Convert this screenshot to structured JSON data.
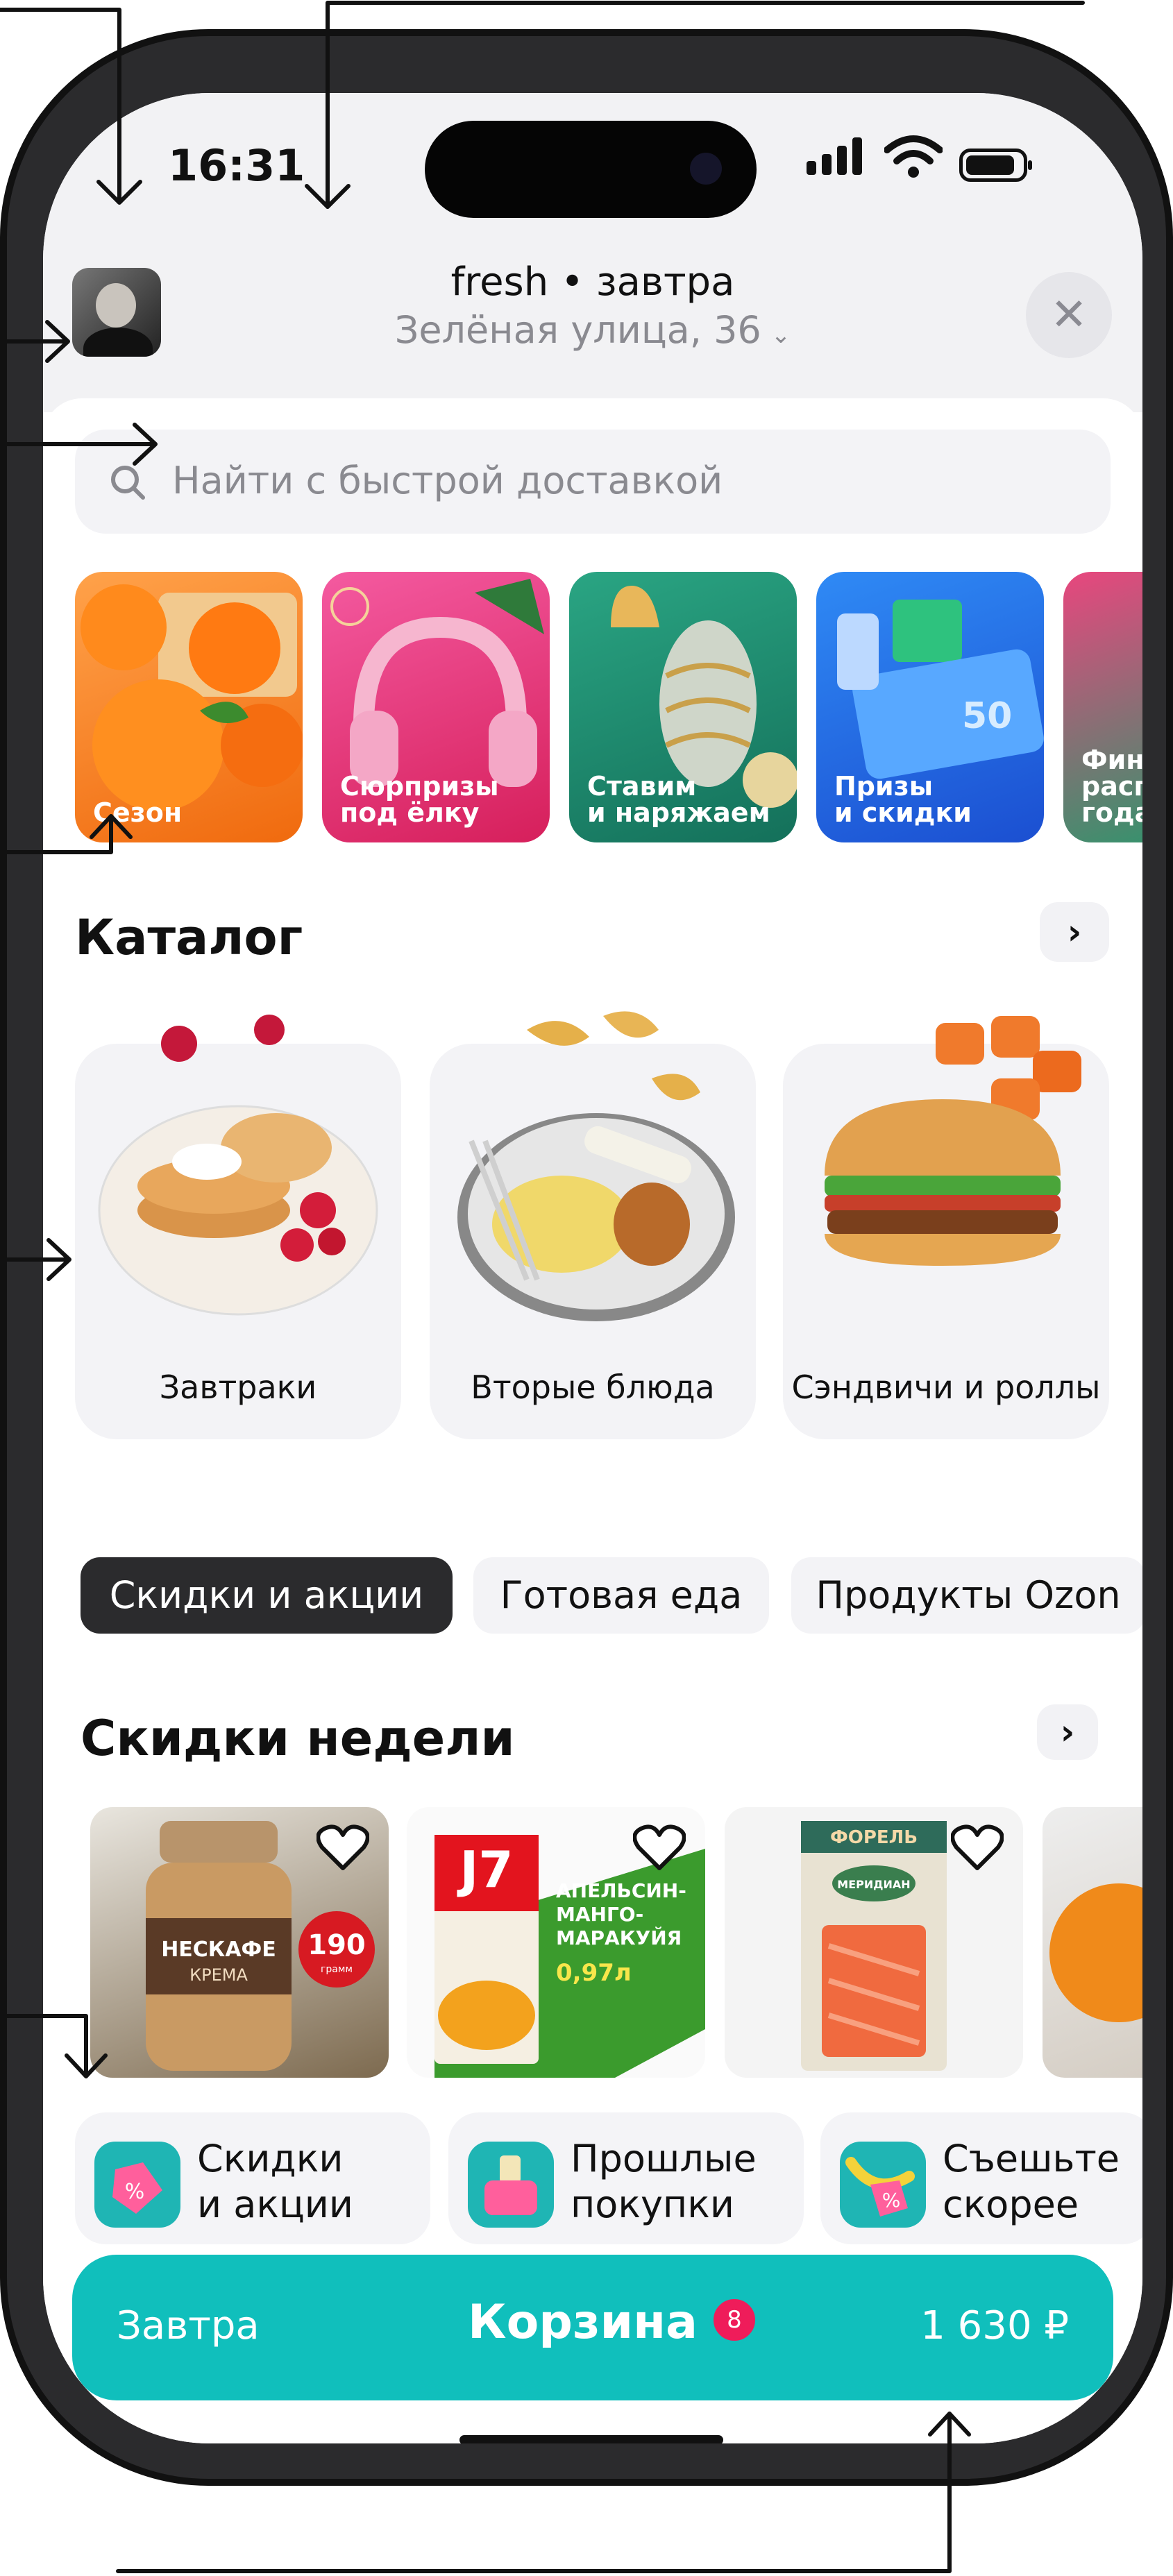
{
  "status_bar": {
    "time": "16:31"
  },
  "header": {
    "brand_line": "fresh • завтра",
    "address": "Зелёная улица, 36",
    "close_glyph": "✕"
  },
  "search": {
    "placeholder": "Найти с быстрой доставкой",
    "icon": "search-icon"
  },
  "stories": [
    {
      "label": "Сезон",
      "bg": "#f57f1f"
    },
    {
      "label": "Сюрпризы\nпод ёлку",
      "bg": "#e8397d"
    },
    {
      "label": "Ставим\nи наряжаем",
      "bg": "#1f8c6e"
    },
    {
      "label": "Призы\nи скидки",
      "bg": "#1f6fe6"
    },
    {
      "label": "Фин\nрасп\nгода",
      "bg": "#1a9e6a"
    }
  ],
  "catalog": {
    "title": "Каталог",
    "items": [
      {
        "name": "Завтраки"
      },
      {
        "name": "Вторые блюда"
      },
      {
        "name": "Сэндвичи и роллы"
      }
    ]
  },
  "chips": [
    {
      "label": "Скидки и акции",
      "active": true
    },
    {
      "label": "Готовая еда",
      "active": false
    },
    {
      "label": "Продукты Ozon",
      "active": false
    }
  ],
  "weekly": {
    "title": "Скидки недели",
    "products": [
      {
        "brand": "НЕСКАФЕ",
        "sub": "КРЕМА",
        "badge_value": "190",
        "badge_unit": "грамм"
      },
      {
        "brand": "J7",
        "flavor": "АПЕЛЬСИН-\nМАНГО-\nМАРАКУЙЯ",
        "volume": "0,97л"
      },
      {
        "brand": "ФОРЕЛЬ",
        "maker": "МЕРИДИАН"
      },
      {}
    ]
  },
  "quick_links": [
    {
      "text": "Скидки\nи акции"
    },
    {
      "text": "Прошлые\nпокупки"
    },
    {
      "text": "Съешьте\nскорее"
    }
  ],
  "cart": {
    "when": "Завтра",
    "title": "Корзина",
    "count": "8",
    "total": "1 630 ₽"
  },
  "colors": {
    "accent": "#10bfbc",
    "badge": "#ef1c5a",
    "chip_active": "#2b2b2d"
  }
}
